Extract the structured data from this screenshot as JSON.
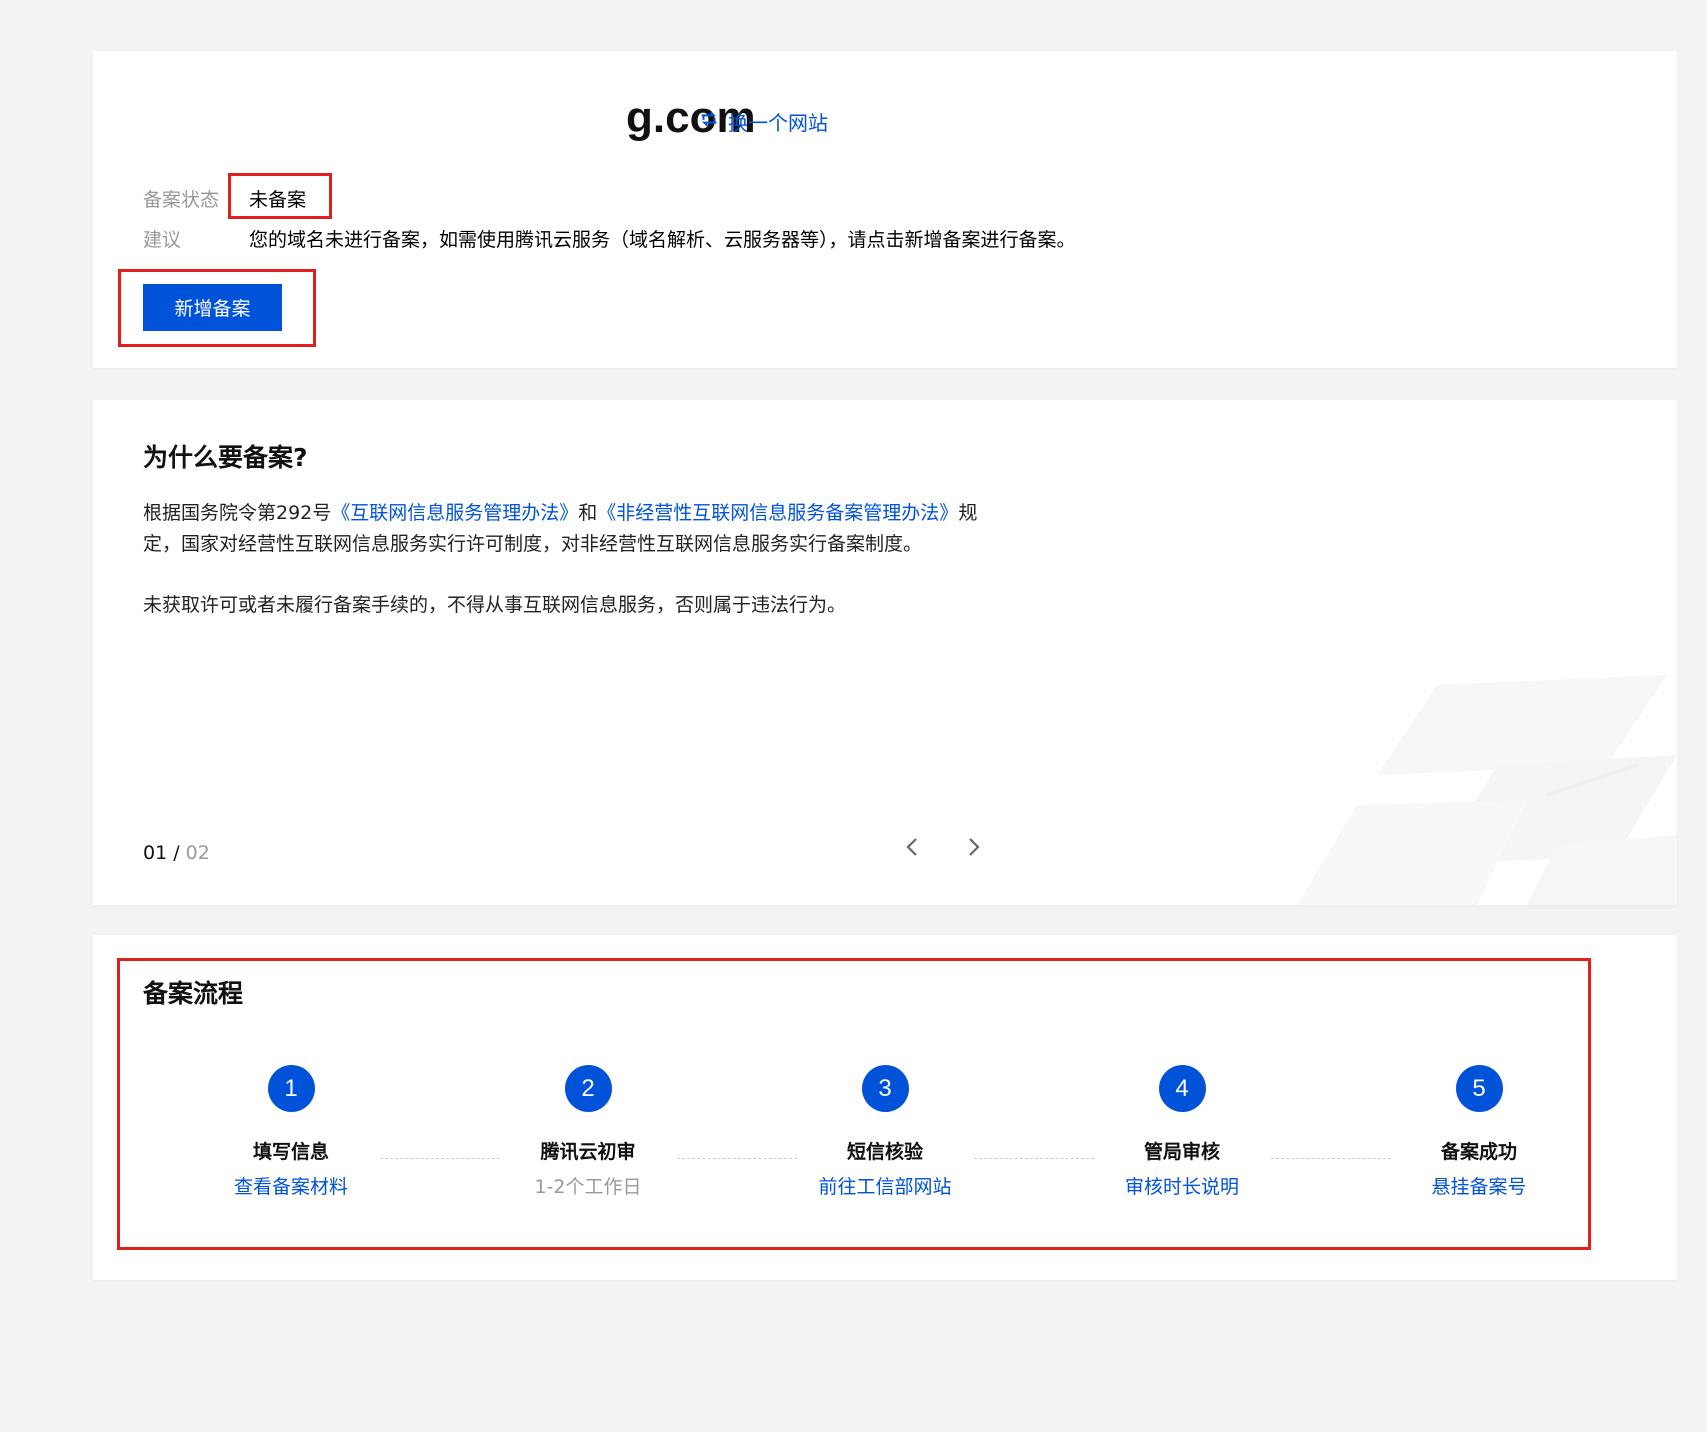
{
  "site": {
    "domain": "g.com",
    "switch_label": "换一个网站"
  },
  "status": {
    "label": "备案状态",
    "value": "未备案",
    "advice_label": "建议",
    "advice_text": "您的域名未进行备案，如需使用腾讯云服务（域名解析、云服务器等），请点击新增备案进行备案。",
    "add_button": "新增备案"
  },
  "why": {
    "title": "为什么要备案?",
    "para1_prefix": "根据国务院令第292号",
    "law1": "《互联网信息服务管理办法》",
    "and": "和",
    "law2": "《非经营性互联网信息服务备案管理办法》",
    "para1_suffix": "规定，国家对经营性互联网信息服务实行许可制度，对非经营性互联网信息服务实行备案制度。",
    "para2": "未获取许可或者未履行备案手续的，不得从事互联网信息服务，否则属于违法行为。",
    "pager_current": "01",
    "pager_sep": " / ",
    "pager_total": "02"
  },
  "process": {
    "title": "备案流程",
    "steps": [
      {
        "num": "1",
        "name": "填写信息",
        "sub": "查看备案材料"
      },
      {
        "num": "2",
        "name": "腾讯云初审",
        "sub": "1-2个工作日"
      },
      {
        "num": "3",
        "name": "短信核验",
        "sub": "前往工信部网站"
      },
      {
        "num": "4",
        "name": "管局审核",
        "sub": "审核时长说明"
      },
      {
        "num": "5",
        "name": "备案成功",
        "sub": "悬挂备案号"
      }
    ]
  },
  "colors": {
    "primary": "#0052d9",
    "highlight_box": "#e0201c",
    "background": "#f2f3f5"
  }
}
